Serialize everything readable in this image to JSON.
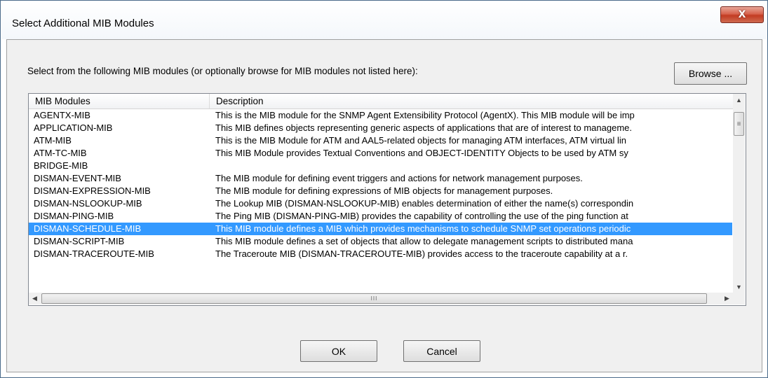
{
  "window": {
    "title": "Select Additional MIB Modules",
    "close_glyph": "X"
  },
  "instruction": "Select from the following MIB modules (or optionally browse for MIB modules not listed here):",
  "browse_label": "Browse ...",
  "table": {
    "columns": [
      "MIB Modules",
      "Description"
    ],
    "selected_index": 9,
    "rows": [
      {
        "module": "AGENTX-MIB",
        "description": "This is the MIB module for the SNMP Agent Extensibility Protocol (AgentX). This MIB module will be imp"
      },
      {
        "module": "APPLICATION-MIB",
        "description": "This MIB defines objects representing generic aspects of applications that are of interest to manageme."
      },
      {
        "module": "ATM-MIB",
        "description": "This is the MIB Module for ATM and AAL5-related objects for managing ATM interfaces, ATM virtual lin"
      },
      {
        "module": "ATM-TC-MIB",
        "description": "This MIB Module provides Textual Conventions and OBJECT-IDENTITY Objects to be used by ATM sy"
      },
      {
        "module": "BRIDGE-MIB",
        "description": ""
      },
      {
        "module": "DISMAN-EVENT-MIB",
        "description": "The MIB module for defining event triggers and actions for network management purposes."
      },
      {
        "module": "DISMAN-EXPRESSION-MIB",
        "description": "The MIB module for defining expressions of MIB objects for management purposes."
      },
      {
        "module": "DISMAN-NSLOOKUP-MIB",
        "description": "The Lookup MIB (DISMAN-NSLOOKUP-MIB) enables determination of either the name(s) correspondin"
      },
      {
        "module": "DISMAN-PING-MIB",
        "description": "The Ping MIB (DISMAN-PING-MIB) provides the capability of controlling the use of the ping function at"
      },
      {
        "module": "DISMAN-SCHEDULE-MIB",
        "description": "This MIB module defines a MIB which provides mechanisms to schedule SNMP set operations periodic"
      },
      {
        "module": "DISMAN-SCRIPT-MIB",
        "description": "This MIB module defines a set of objects that allow to delegate management scripts to distributed mana"
      },
      {
        "module": "DISMAN-TRACEROUTE-MIB",
        "description": "The Traceroute MIB (DISMAN-TRACEROUTE-MIB) provides access to the traceroute capability at a r."
      }
    ]
  },
  "scrollbars": {
    "up": "▲",
    "down": "▼",
    "left": "◀",
    "right": "▶",
    "thumb_grip_v": "≡",
    "thumb_grip_h": "III"
  },
  "ok_label": "OK",
  "cancel_label": "Cancel",
  "colors": {
    "selection": "#3399ff",
    "close_button": "#c9452d"
  }
}
